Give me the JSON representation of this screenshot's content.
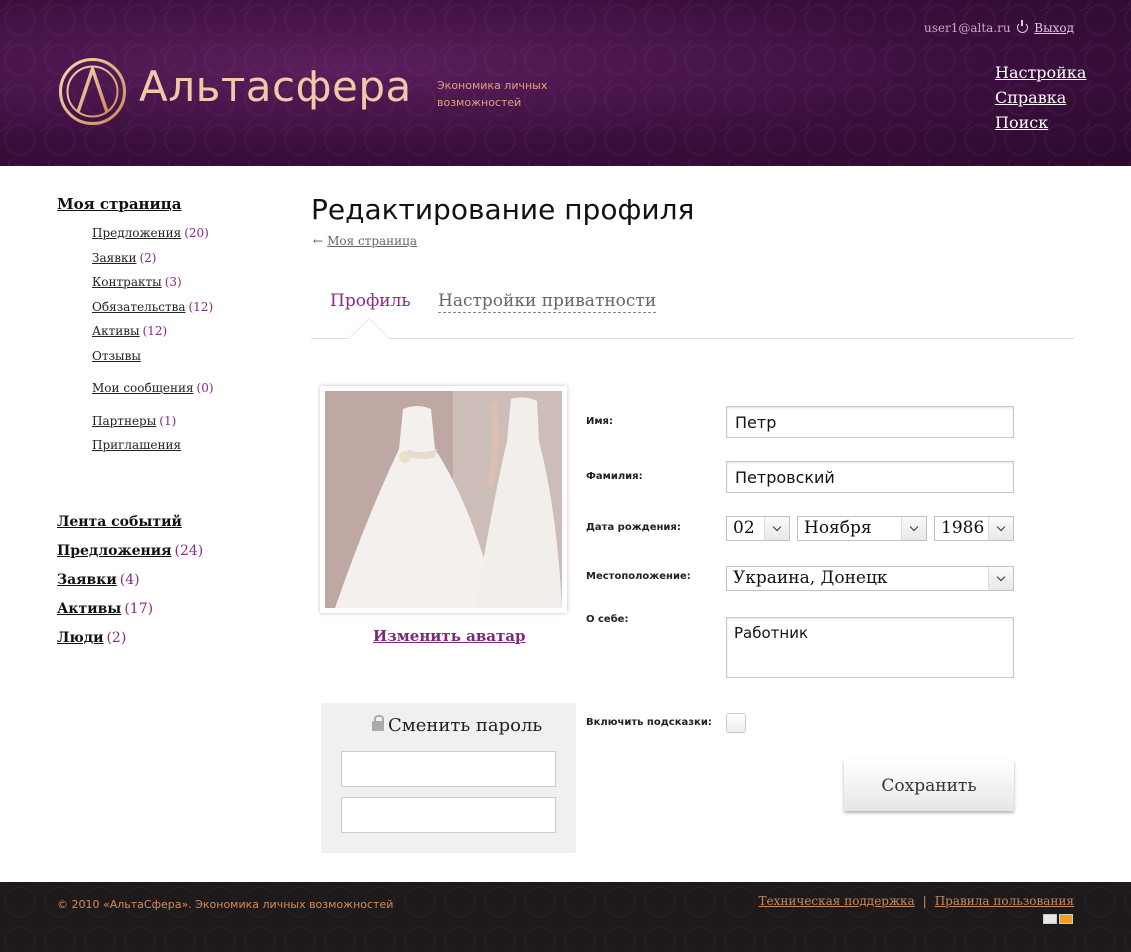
{
  "header": {
    "brand": "Альтасфера",
    "tagline": "Экономика личных возможностей",
    "user_email": "user1@alta.ru",
    "logout": "Выход",
    "nav": [
      "Настройка",
      "Справка",
      "Поиск"
    ]
  },
  "sidebar": {
    "title": "Моя страница",
    "items": [
      {
        "label": "Предложения",
        "count": "(20)"
      },
      {
        "label": "Заявки",
        "count": "(2)"
      },
      {
        "label": "Контракты",
        "count": "(3)"
      },
      {
        "label": "Обязательства",
        "count": "(12)"
      },
      {
        "label": "Активы",
        "count": "(12)"
      },
      {
        "label": "Отзывы",
        "count": ""
      },
      {
        "label": "Мои сообщения",
        "count": "(0)"
      },
      {
        "label": "Партнеры",
        "count": "(1)"
      },
      {
        "label": "Приглашения",
        "count": ""
      }
    ],
    "secondary": [
      {
        "label": "Лента событий",
        "count": ""
      },
      {
        "label": "Предложения",
        "count": "(24)"
      },
      {
        "label": "Заявки",
        "count": "(4)"
      },
      {
        "label": "Активы",
        "count": "(17)"
      },
      {
        "label": "Люди",
        "count": "(2)"
      }
    ]
  },
  "main": {
    "title": "Редактирование профиля",
    "back_link": "Моя страница",
    "tabs": [
      {
        "label": "Профиль",
        "active": true
      },
      {
        "label": "Настройки приватности",
        "active": false
      }
    ],
    "change_avatar": "Изменить аватар",
    "password": {
      "title": "Сменить пароль",
      "field1": "",
      "field2": ""
    },
    "form": {
      "first_name_label": "Имя:",
      "first_name": "Петр",
      "last_name_label": "Фамилия:",
      "last_name": "Петровский",
      "birth_label": "Дата рождения:",
      "birth_day": "02",
      "birth_month": "Ноября",
      "birth_year": "1986",
      "location_label": "Местоположение:",
      "location": "Украина, Донецк",
      "about_label": "О себе:",
      "about": "Работник",
      "hints_label": "Включить подсказки:",
      "hints_enabled": false,
      "save": "Сохранить"
    }
  },
  "footer": {
    "copyright": "© 2010 «АльтаСфера». Экономика личных возможностей",
    "support": "Техническая поддержка",
    "separator": "|",
    "rules": "Правила пользования"
  },
  "colors": {
    "header_bg": "#3c0f3e",
    "brand_text": "#f0c9a8",
    "accent_purple": "#8a2a86",
    "footer_bg": "#1e1a1b",
    "footer_text": "#d98a55"
  }
}
